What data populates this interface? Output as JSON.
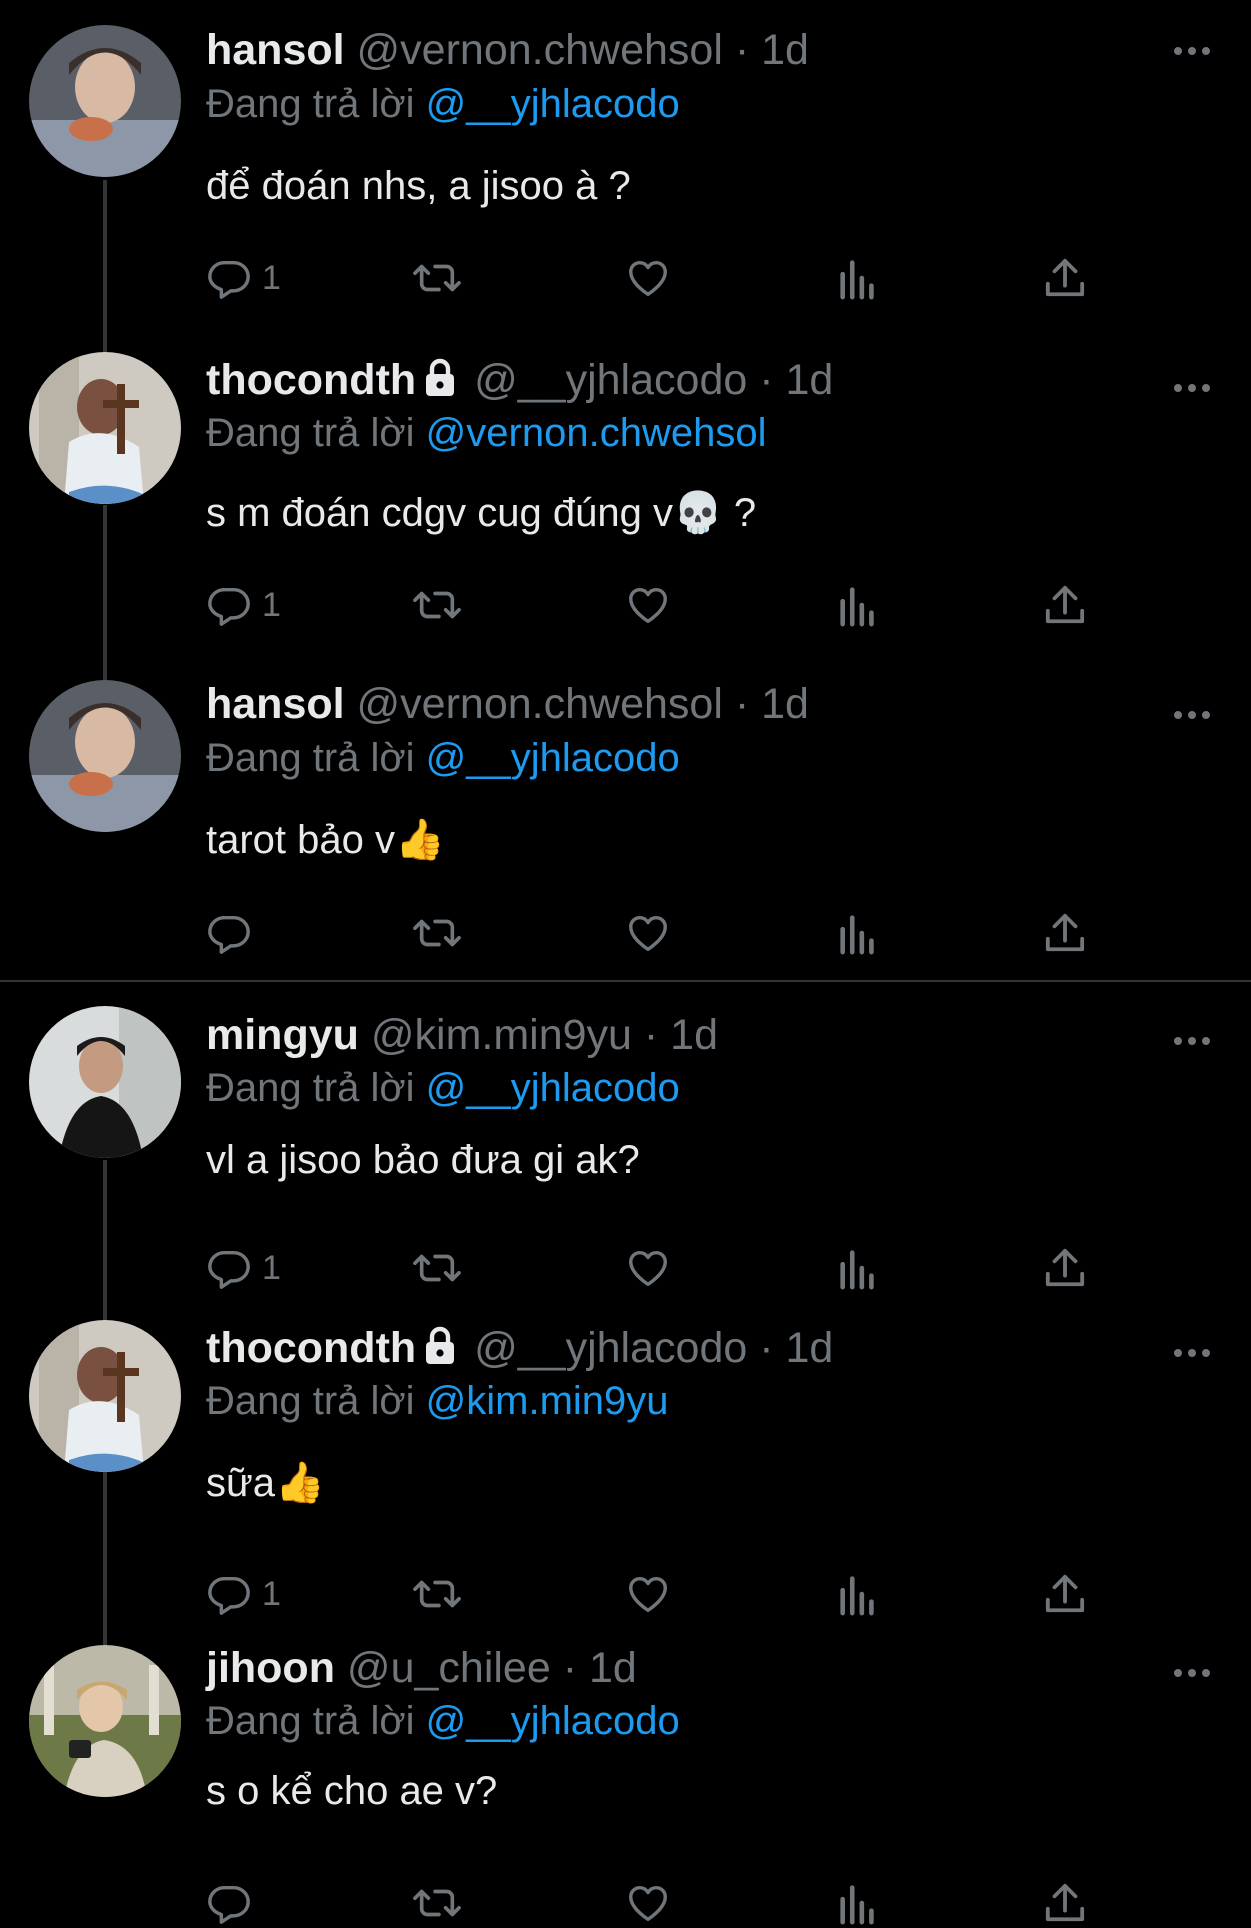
{
  "reply_prefix": "Đang trả lời",
  "tweets": [
    {
      "name": "hansol",
      "handle": "@vernon.chwehsol",
      "time": "· 1d",
      "reply_to": "@__yjhlacodo",
      "text": "để đoán nhs, a jisoo à ?",
      "reply_count": "1",
      "locked": false
    },
    {
      "name": "thocondth",
      "handle": "@__yjhlacodo",
      "time": "· 1d",
      "reply_to": "@vernon.chwehsol",
      "text": "s m đoán cdgv cug đúng v💀 ?",
      "reply_count": "1",
      "locked": true
    },
    {
      "name": "hansol",
      "handle": "@vernon.chwehsol",
      "time": "· 1d",
      "reply_to": "@__yjhlacodo",
      "text": "tarot bảo v👍",
      "reply_count": "",
      "locked": false
    },
    {
      "name": "mingyu",
      "handle": "@kim.min9yu",
      "time": "· 1d",
      "reply_to": "@__yjhlacodo",
      "text": "vl a jisoo bảo đưa gi ak?",
      "reply_count": "1",
      "locked": false
    },
    {
      "name": "thocondth",
      "handle": "@__yjhlacodo",
      "time": "· 1d",
      "reply_to": "@kim.min9yu",
      "text": "sữa👍",
      "reply_count": "1",
      "locked": true
    },
    {
      "name": "jihoon",
      "handle": "@u_chilee",
      "time": "· 1d",
      "reply_to": "@__yjhlacodo",
      "text": "s o kể cho ae v?",
      "reply_count": "",
      "locked": false
    }
  ],
  "icons": {
    "reply": "reply-icon",
    "retweet": "retweet-icon",
    "like": "heart-icon",
    "views": "views-icon",
    "share": "share-icon",
    "more": "more-icon",
    "lock": "lock-icon"
  },
  "colors": {
    "background": "#000000",
    "name": "#e7e9ea",
    "muted": "#71767b",
    "mention": "#1d9bf0",
    "thread_line": "#333639"
  }
}
